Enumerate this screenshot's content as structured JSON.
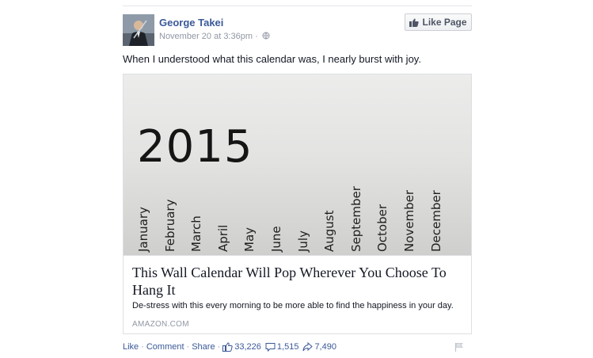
{
  "post": {
    "author": "George Takei",
    "timestamp": "November 20 at 3:36pm",
    "meta_separator": "·",
    "audience_icon": "globe-icon",
    "like_page_label": "Like Page",
    "status_text": "When I understood what this calendar was, I nearly burst with joy."
  },
  "link": {
    "image": {
      "year": "2015",
      "months": [
        "January",
        "February",
        "March",
        "April",
        "May",
        "June",
        "July",
        "August",
        "September",
        "October",
        "November",
        "December"
      ]
    },
    "title": "This Wall Calendar Will Pop Wherever You Choose To Hang It",
    "description": "De-stress with this every morning to be more able to find the happiness in your day.",
    "source": "AMAZON.COM"
  },
  "actions": {
    "like": "Like",
    "comment": "Comment",
    "share": "Share",
    "separator": "·",
    "likes_count": "33,226",
    "comments_count": "1,515",
    "shares_count": "7,490"
  },
  "colors": {
    "link_blue": "#3b5998",
    "meta_gray": "#9197a3",
    "text": "#141823"
  }
}
